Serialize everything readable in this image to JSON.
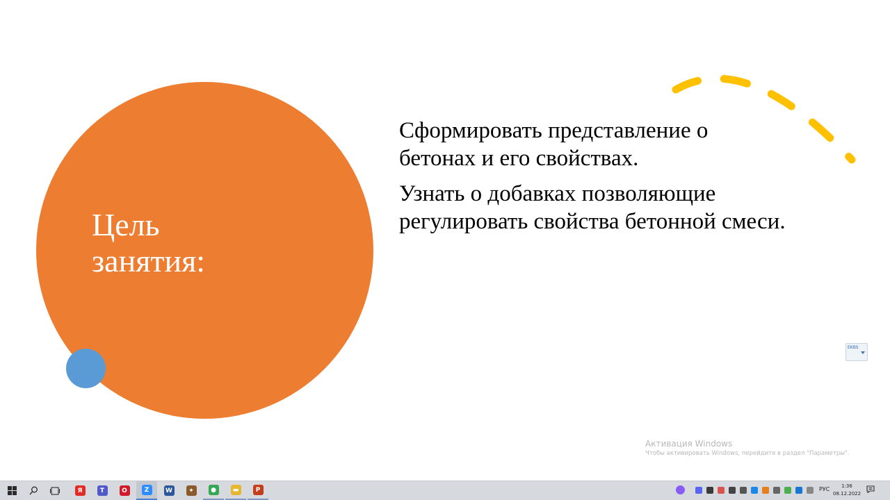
{
  "slide": {
    "title_line1": "Цель",
    "title_line2": "занятия:",
    "paragraphs": [
      "Сформировать представление о бетонах и его свойствах.",
      "Узнать о  добавках позволяющие регулировать свойства бетонной смеси."
    ],
    "colors": {
      "big_circle": "#ed7d31",
      "small_circle": "#5b9bd5",
      "arc": "#ffc000"
    }
  },
  "language_widget": {
    "label": "EKBS"
  },
  "activation": {
    "title": "Активация Windows",
    "subtitle": "Чтобы активировать Windows, перейдите в раздел \"Параметры\"."
  },
  "taskbar": {
    "apps": [
      {
        "name": "yandex-browser",
        "glyph": "Я",
        "color": "#e22b24"
      },
      {
        "name": "teams",
        "glyph": "T",
        "color": "#5059c9"
      },
      {
        "name": "opera",
        "glyph": "O",
        "color": "#d21b2a"
      },
      {
        "name": "zoom",
        "glyph": "Z",
        "color": "#2d8cff"
      },
      {
        "name": "word",
        "glyph": "W",
        "color": "#2b579a"
      },
      {
        "name": "app-unknown",
        "glyph": "✦",
        "color": "#8a5a2b"
      },
      {
        "name": "chrome",
        "glyph": "●",
        "color": "#34a853"
      },
      {
        "name": "file-explorer",
        "glyph": "▬",
        "color": "#e8b730"
      },
      {
        "name": "powerpoint",
        "glyph": "P",
        "color": "#c43e1c"
      }
    ],
    "tray_language": "РУС",
    "time": "1:36",
    "date": "08.12.2022"
  }
}
